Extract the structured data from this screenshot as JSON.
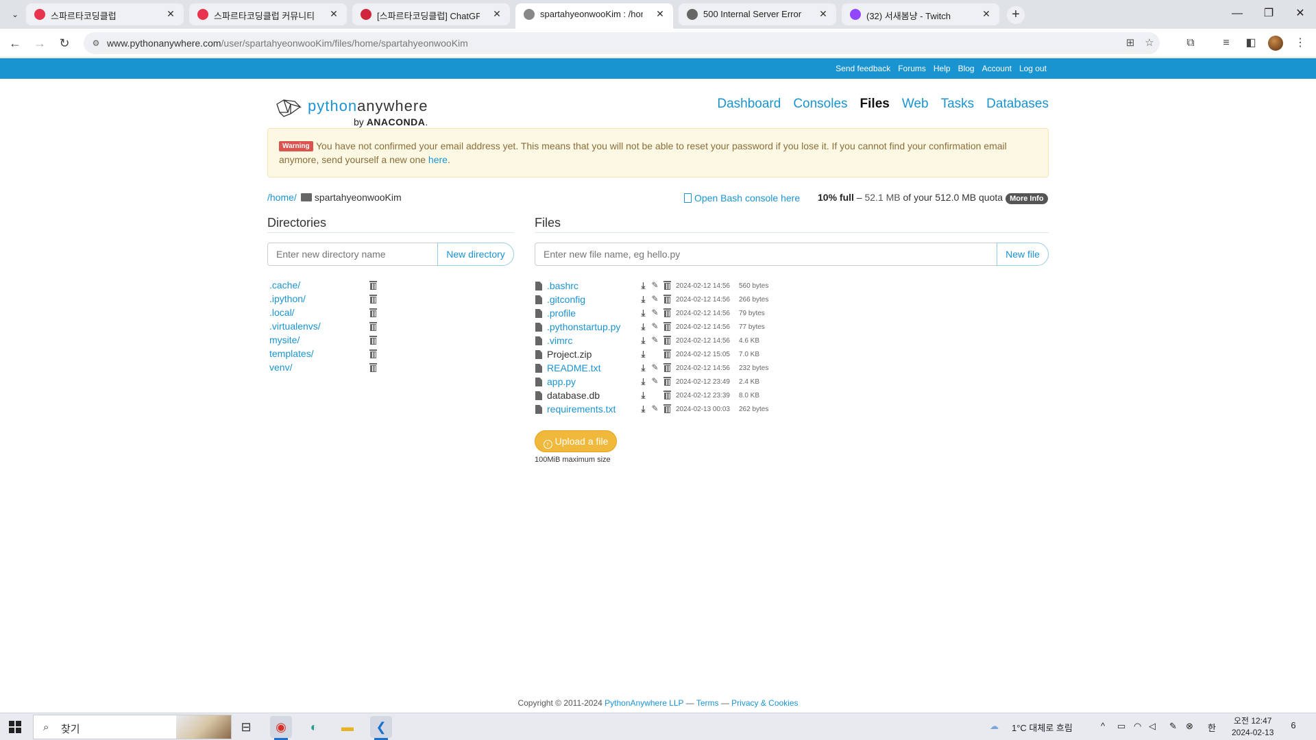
{
  "browser": {
    "tabs": [
      {
        "title": "스파르타코딩클럽",
        "favicon_color": "#e8344e",
        "active": false
      },
      {
        "title": "스파르타코딩클럽 커뮤니티 | 스",
        "favicon_color": "#e8344e",
        "active": false
      },
      {
        "title": "[스파르타코딩클럽] ChatGPT 를",
        "favicon_color": "#d1253b",
        "active": false
      },
      {
        "title": "spartahyeonwooKim : /home/s",
        "favicon_color": "#888888",
        "active": true
      },
      {
        "title": "500 Internal Server Error",
        "favicon_color": "#666666",
        "active": false
      },
      {
        "title": "(32) 서새봄냥 - Twitch",
        "favicon_color": "#9146ff",
        "active": false
      }
    ],
    "url_host": "www.pythonanywhere.com",
    "url_path": "/user/spartahyeonwooKim/files/home/spartahyeonwooKim"
  },
  "site": {
    "top_links": [
      "Send feedback",
      "Forums",
      "Help",
      "Blog",
      "Account",
      "Log out"
    ],
    "logo": {
      "python": "python",
      "anywhere": "anywhere",
      "by": "by",
      "anaconda": "ANACONDA",
      "dot": "."
    },
    "nav": [
      {
        "label": "Dashboard",
        "current": false
      },
      {
        "label": "Consoles",
        "current": false
      },
      {
        "label": "Files",
        "current": true
      },
      {
        "label": "Web",
        "current": false
      },
      {
        "label": "Tasks",
        "current": false
      },
      {
        "label": "Databases",
        "current": false
      }
    ],
    "warning": {
      "badge": "Warning",
      "message": "You have not confirmed your email address yet. This means that you will not be able to reset your password if you lose it. If you cannot find your confirmation email anymore, send yourself a new one ",
      "link": "here",
      "end": "."
    },
    "breadcrumb": {
      "home": "/home/",
      "current": "spartahyeonwooKim"
    },
    "bash_link": "Open Bash console here",
    "quota": {
      "pct": "10% full",
      "dash": " – ",
      "used": "52.1 MB",
      "rest": " of your 512.0 MB quota",
      "more": "More Info"
    },
    "directories": {
      "title": "Directories",
      "placeholder": "Enter new directory name",
      "button": "New directory",
      "items": [
        ".cache/",
        ".ipython/",
        ".local/",
        ".virtualenvs/",
        "mysite/",
        "templates/",
        "venv/"
      ]
    },
    "files": {
      "title": "Files",
      "placeholder": "Enter new file name, eg hello.py",
      "button": "New file",
      "items": [
        {
          "name": ".bashrc",
          "editable": true,
          "date": "2024-02-12 14:56",
          "size": "560 bytes"
        },
        {
          "name": ".gitconfig",
          "editable": true,
          "date": "2024-02-12 14:56",
          "size": "266 bytes"
        },
        {
          "name": ".profile",
          "editable": true,
          "date": "2024-02-12 14:56",
          "size": "79 bytes"
        },
        {
          "name": ".pythonstartup.py",
          "editable": true,
          "date": "2024-02-12 14:56",
          "size": "77 bytes"
        },
        {
          "name": ".vimrc",
          "editable": true,
          "date": "2024-02-12 14:56",
          "size": "4.6 KB"
        },
        {
          "name": "Project.zip",
          "editable": false,
          "date": "2024-02-12 15:05",
          "size": "7.0 KB"
        },
        {
          "name": "README.txt",
          "editable": true,
          "date": "2024-02-12 14:56",
          "size": "232 bytes"
        },
        {
          "name": "app.py",
          "editable": true,
          "date": "2024-02-12 23:49",
          "size": "2.4 KB"
        },
        {
          "name": "database.db",
          "editable": false,
          "date": "2024-02-12 23:39",
          "size": "8.0 KB"
        },
        {
          "name": "requirements.txt",
          "editable": true,
          "date": "2024-02-13 00:03",
          "size": "262 bytes"
        }
      ],
      "upload": "Upload a file",
      "max_size": "100MiB maximum size"
    },
    "footer": {
      "copyright": "Copyright © 2011-2024 ",
      "company": "PythonAnywhere LLP",
      "sep1": " — ",
      "terms": "Terms",
      "sep2": " — ",
      "privacy": "Privacy & Cookies"
    }
  },
  "taskbar": {
    "search": "찾기",
    "weather": "1°C  대체로 흐림",
    "ime": "한",
    "time": "오전 12:47",
    "date": "2024-02-13",
    "notifications": "6"
  }
}
